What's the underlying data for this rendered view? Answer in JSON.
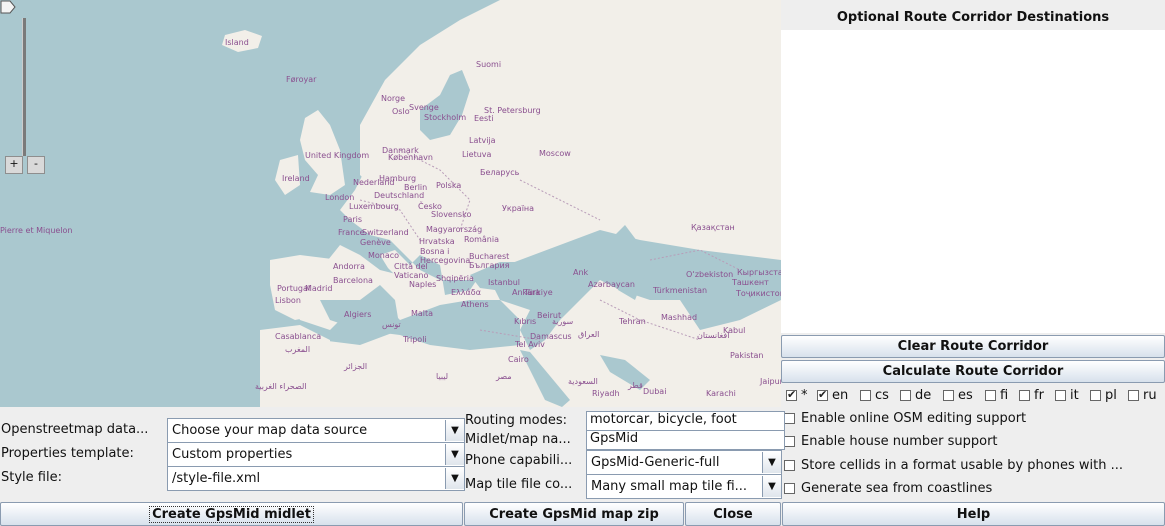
{
  "map": {
    "labels": [
      "Island",
      "Føroyar",
      "Norge",
      "Suomi",
      "Svenge",
      "Oslo",
      "Stockholm",
      "St. Petersburg",
      "Eesti",
      "Latvija",
      "Lietuva",
      "Danmark",
      "København",
      "United Kingdom",
      "Ireland",
      "Moscow",
      "Nederland",
      "Hamburg",
      "Berlin",
      "Polska",
      "Беларусь",
      "London",
      "Deutschland",
      "Luxembourg",
      "Česko",
      "Slovensko",
      "Україна",
      "Paris",
      "France",
      "Switzerland",
      "Genève",
      "Magyarország",
      "România",
      "Hrvatska",
      "Bosna i Hercegovina",
      "Bucharest",
      "България",
      "Monaco",
      "Città del Vaticano",
      "Andorra",
      "Barcelona",
      "Portugal",
      "Madrid",
      "Lisbon",
      "Naples",
      "Shqipëria",
      "Istanbul",
      "Türkiye",
      "Ελλάδα",
      "Athens",
      "Algiers",
      "Malta",
      "تونس",
      "Tripoli",
      "Casablanca",
      "Kıbrıs",
      "Beirut",
      "Damascus",
      "سورية",
      "العراق",
      "Cairo",
      "مصر",
      "الجزائر",
      "ليبيا",
      "Tel Aviv",
      "Riyadh",
      "Dubai",
      "Tehran",
      "Mashhad",
      "Kabul",
      "افغانستان",
      "Pakistan",
      "Karachi",
      "Jaipur",
      "Қазақстан",
      "O‘zbekiston",
      "Türkmenistan",
      "Кыргызстан",
      "Ташкент",
      "Тоҷикистон",
      "Azərbaycan",
      "Ankara",
      "Pierre et Miquelon",
      "المغرب",
      "الصحراء الغربية",
      "السعودية",
      "قطر",
      "Ank"
    ],
    "zoom_in": "+",
    "zoom_out": "-"
  },
  "corridor": {
    "title": "Optional Route Corridor Destinations",
    "clear_label": "Clear Route Corridor",
    "calculate_label": "Calculate Route Corridor"
  },
  "languages": [
    {
      "code": "*",
      "checked": true
    },
    {
      "code": "en",
      "checked": true
    },
    {
      "code": "cs",
      "checked": false
    },
    {
      "code": "de",
      "checked": false
    },
    {
      "code": "es",
      "checked": false
    },
    {
      "code": "fi",
      "checked": false
    },
    {
      "code": "fr",
      "checked": false
    },
    {
      "code": "it",
      "checked": false
    },
    {
      "code": "pl",
      "checked": false
    },
    {
      "code": "ru",
      "checked": false
    }
  ],
  "options": {
    "osm_editing": "Enable online OSM editing support",
    "house_number": "Enable house number support",
    "cellids": "Store cellids in a format usable by phones with ...",
    "sea": "Generate sea from coastlines"
  },
  "form": {
    "osm_label": "Openstreetmap data...",
    "osm_value": "Choose your map data source",
    "props_label": "Properties template:",
    "props_value": "Custom properties",
    "style_label": "Style file:",
    "style_value": "/style-file.xml",
    "routing_label": "Routing modes:",
    "routing_value": "motorcar, bicycle, foot",
    "midlet_label": "Midlet/map na...",
    "midlet_value": "GpsMid",
    "phone_label": "Phone capabili...",
    "phone_value": "GpsMid-Generic-full",
    "tile_label": "Map tile file co...",
    "tile_value": "Many small map tile fi..."
  },
  "buttons": {
    "create_midlet": "Create GpsMid midlet",
    "create_zip": "Create GpsMid map zip",
    "close": "Close",
    "help": "Help"
  },
  "colors": {
    "sea": "#aac8cf",
    "land": "#f2efe9",
    "border": "#b89cb8",
    "label": "#8a4f8f"
  }
}
